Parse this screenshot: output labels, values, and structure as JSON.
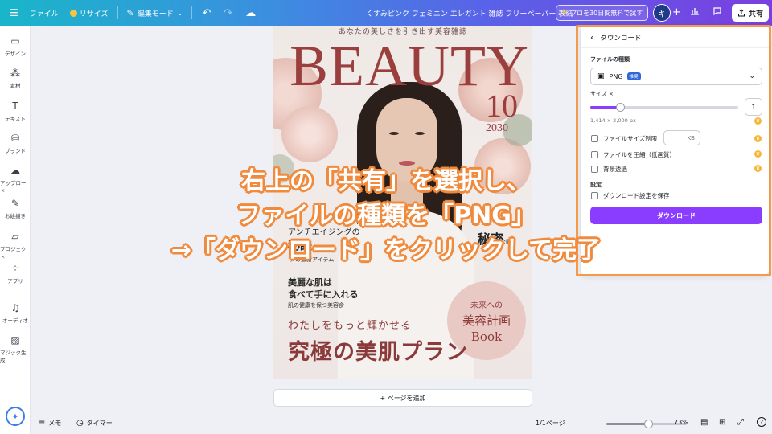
{
  "topbar": {
    "menu_icon": "hamburger-icon",
    "file_label": "ファイル",
    "resize_label": "リサイズ",
    "edit_mode_label": "編集モード",
    "title": "くすみピンク フェミニン エレガント 雑誌 フリーペーパー 表紙",
    "pro_trial_label": "プロを30日間無料で試す",
    "avatar_initial": "キ",
    "share_label": "共有"
  },
  "rail": {
    "items": [
      {
        "label": "デザイン",
        "icon": "layout-icon"
      },
      {
        "label": "素材",
        "icon": "elements-icon"
      },
      {
        "label": "テキスト",
        "icon": "text-icon"
      },
      {
        "label": "ブランド",
        "icon": "brand-icon"
      },
      {
        "label": "アップロード",
        "icon": "upload-icon"
      },
      {
        "label": "お絵描き",
        "icon": "draw-icon"
      },
      {
        "label": "プロジェクト",
        "icon": "folder-icon"
      },
      {
        "label": "アプリ",
        "icon": "apps-icon"
      },
      {
        "label": "オーディオ",
        "icon": "music-icon"
      },
      {
        "label": "マジック生成",
        "icon": "magic-image-icon"
      }
    ]
  },
  "cover": {
    "tagline": "あなたの美しさを引き出す美容雑誌",
    "headline": "BEAUTY",
    "issue_number": "10",
    "issue_year": "2030",
    "left_feature_small": "アンチエイジングの",
    "left_feature_big": "秘訣",
    "left_feature_caption": "アの最新アイテム",
    "right_feature_big": "秘密",
    "right_feature_caption": "秘密を大公開",
    "skin_line1": "美麗な肌は",
    "skin_line2": "食べて手に入れる",
    "skin_caption": "肌の健康を保つ美容食",
    "circle_line1": "未来への",
    "circle_line2": "美容計画",
    "circle_line3": "Book",
    "sub_headline": "わたしをもっと輝かせる",
    "main_headline": "究極の美肌プラン"
  },
  "canvas": {
    "add_page_label": "+ ページを追加"
  },
  "bottombar": {
    "memo_label": "メモ",
    "timer_label": "タイマー",
    "page_indicator": "1/1ページ",
    "zoom_value": 0.73,
    "zoom_label": "73%"
  },
  "download_panel": {
    "title": "ダウンロード",
    "file_type_label": "ファイルの種類",
    "file_type_value": "PNG",
    "file_type_badge": "推奨",
    "size_label": "サイズ ×",
    "size_value": "1",
    "size_slider_value": 0.2,
    "dimensions": "1,414 × 2,000 px",
    "limit_size_label": "ファイルサイズ制限",
    "kb_unit": "KB",
    "compress_label": "ファイルを圧縮（低画質）",
    "transparent_label": "背景透過",
    "settings_label": "設定",
    "save_settings_label": "ダウンロード設定を保存",
    "download_button_label": "ダウンロード",
    "highlight_color": "#f59a4a"
  },
  "overlay": {
    "line1": "右上の「共有」を選択し、",
    "line2": "ファイルの種類を「PNG」",
    "line3": "→「ダウンロード」をクリックして完了"
  },
  "colors": {
    "primary": "#8b3dff",
    "accent_orange": "#f08a3c",
    "cover_red": "#9b3e3e"
  }
}
